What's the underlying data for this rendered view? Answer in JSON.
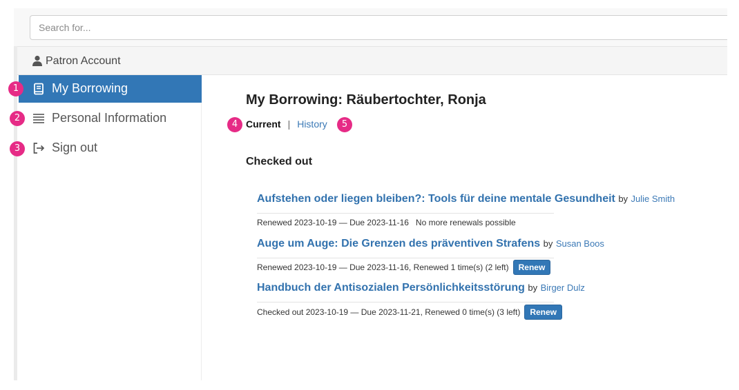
{
  "search": {
    "placeholder": "Search for..."
  },
  "account": {
    "label": "Patron Account"
  },
  "sidebar": {
    "items": [
      {
        "label": "My Borrowing",
        "badge": "1"
      },
      {
        "label": "Personal Information",
        "badge": "2"
      },
      {
        "label": "Sign out",
        "badge": "3"
      }
    ]
  },
  "main": {
    "title": "My Borrowing: Räubertochter, Ronja",
    "tabs": [
      {
        "label": "Current",
        "badge": "4"
      },
      {
        "separator": "|"
      },
      {
        "label": "History",
        "badge": "5"
      }
    ],
    "section_title": "Checked out",
    "loans": [
      {
        "title": "Aufstehen oder liegen bleiben?: Tools für deine mentale Gesundheit",
        "by": "by",
        "author": "Julie Smith",
        "status": "Renewed 2023-10-19 — Due 2023-11-16   No more renewals possible"
      },
      {
        "title": "Auge um Auge: Die Grenzen des präventiven Strafens",
        "by": "by",
        "author": "Susan Boos",
        "status": "Renewed 2023-10-19 — Due 2023-11-16, Renewed 1 time(s) (2 left)",
        "button": "Renew"
      },
      {
        "title": "Handbuch der Antisozialen Persönlichkeitsstörung",
        "by": "by",
        "author": "Birger Dulz",
        "status": "Checked out 2023-10-19 — Due 2023-11-21, Renewed 0 time(s) (3 left)",
        "button": "Renew"
      }
    ]
  },
  "colors": {
    "accent": "#3277b6",
    "badge": "#e62b86",
    "link": "#3272ae"
  }
}
